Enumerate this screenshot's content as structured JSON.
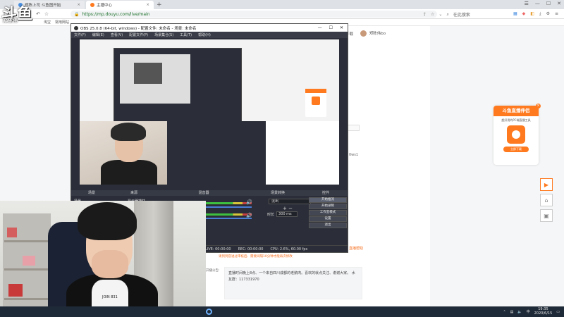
{
  "browser": {
    "tabs": [
      {
        "label": "郑陈上司 斗鱼图开始"
      },
      {
        "label": "主播中心"
      }
    ],
    "url": "https://mp.douyu.com/live/main",
    "search_label": "在此搜索",
    "bookmarks": [
      "淘宝",
      "常用网站"
    ]
  },
  "site": {
    "header_items": [
      "下载",
      "郑陈伟bo"
    ],
    "code_text": "0ws1",
    "orange_text": "直播帮助",
    "orange_text2": "请到到官进过审核后、需要间隔10分钟才能再次修改",
    "notice_label": "开播公告:",
    "notice_text": "直播时间晚上8点、一个来自四川成都的老鹅肉。喜欢的就点关注、谢谢大家。 水友群：117331970",
    "promo": {
      "title": "斗鱼直播伴侣",
      "subtitle": "超好用的PC端直播工具",
      "logo_text": "斗鱼直播伴侣",
      "button": "立即下载"
    }
  },
  "obs": {
    "title": "OBS 25.0.8 (64-bit, windows) - 配置文件: 未命名 - 场景: 未命名",
    "menu": [
      "文件(F)",
      "编辑(E)",
      "查看(V)",
      "配置文件(P)",
      "场景集合(S)",
      "工具(T)",
      "帮助(H)"
    ],
    "docks": [
      "场景",
      "来源",
      "混音器",
      "场景转换",
      "控件"
    ],
    "scene_item": "场景",
    "source_item": "显示器捕获",
    "transition": "淡出",
    "duration_label": "时长",
    "duration_value": "300 ms",
    "controls": [
      "开始推流",
      "开始录制",
      "工作室模式",
      "设置",
      "退出"
    ],
    "status": [
      "LIVE: 00:00:00",
      "REC: 00:00:00",
      "CPU: 2.6%, 60.00 fps"
    ]
  },
  "webcam": {
    "shirt_text": "JOIN 831"
  },
  "logo": {
    "big": "斗鱼",
    "small": "郑陈伟"
  },
  "taskbar": {
    "time": "19:35",
    "date": "2020/6/15"
  }
}
